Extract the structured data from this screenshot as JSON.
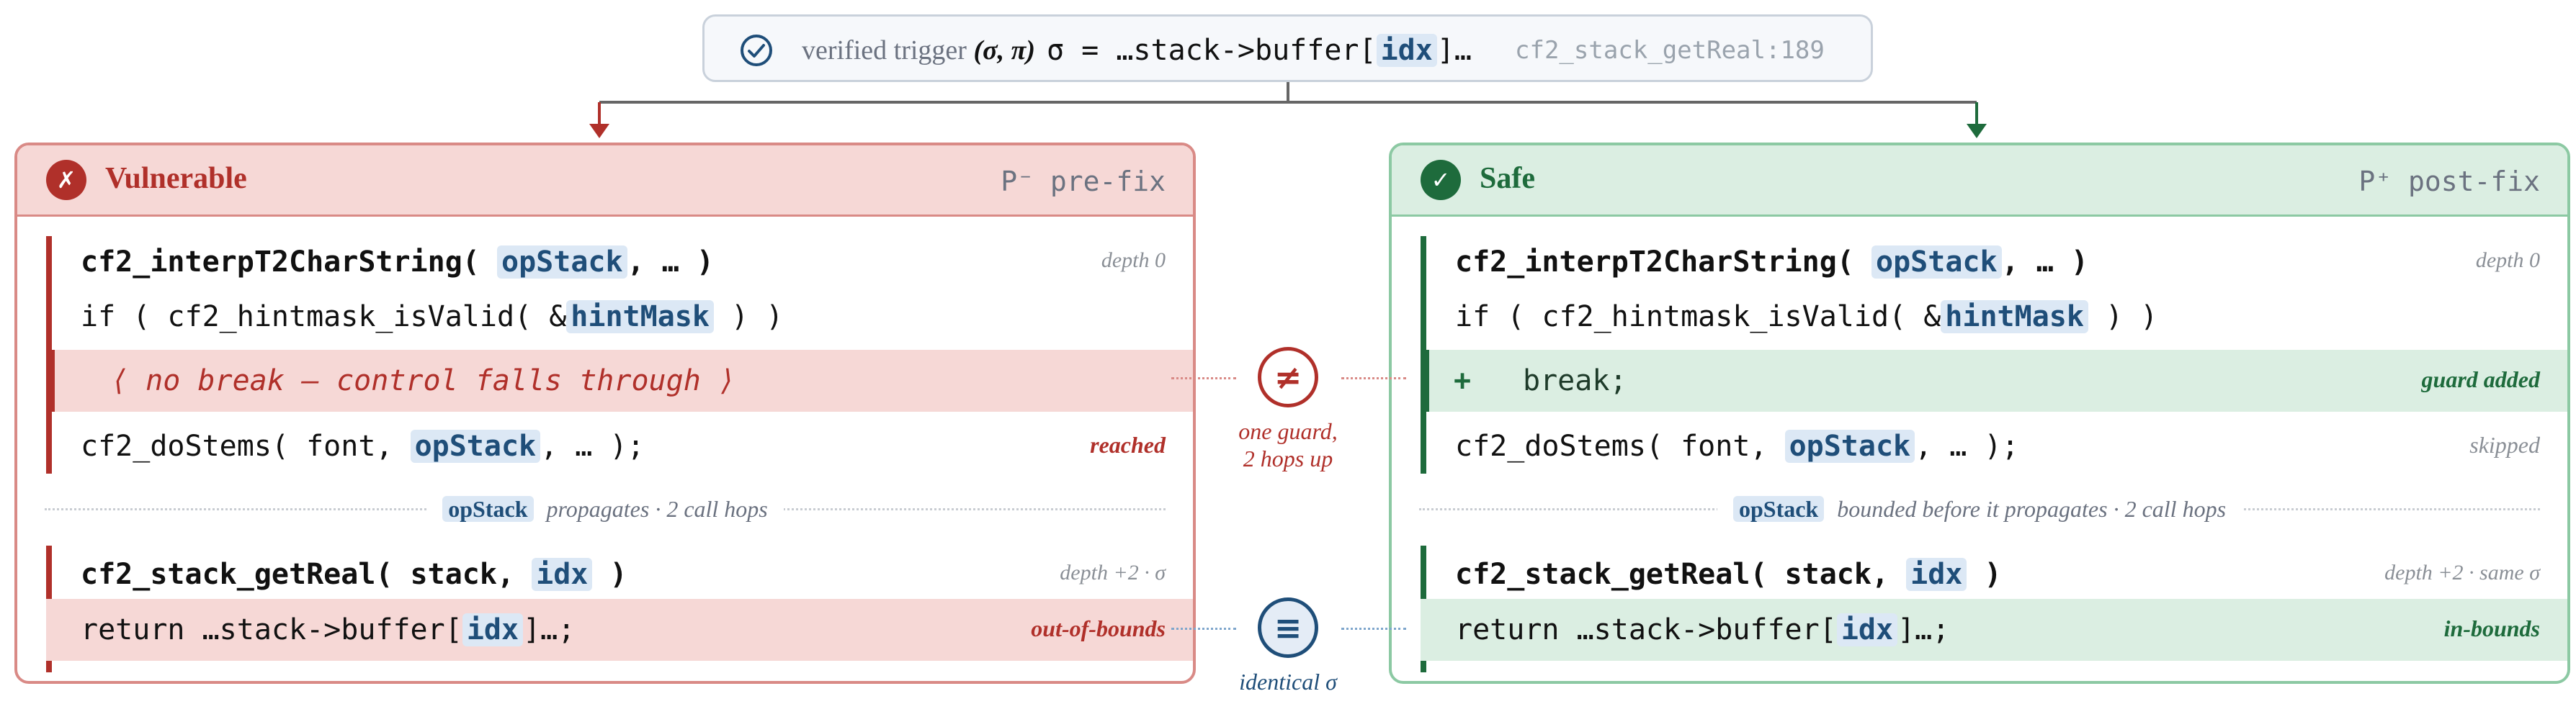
{
  "trigger": {
    "label": "verified trigger",
    "pair": "(σ, π)",
    "expr_prefix": "σ = …stack->buffer[",
    "expr_token": "idx",
    "expr_suffix": "]…",
    "location": "cf2_stack_getReal:189"
  },
  "vulnerable": {
    "badge": "✗",
    "title": "Vulnerable",
    "subtitle": "P⁻ pre-fix",
    "fn_name": "cf2_interpT2CharString(",
    "fn_token": "opStack",
    "fn_rest": ", … )",
    "fn_note": "depth 0",
    "if_prefix": "if ( cf2_hintmask_isValid( &",
    "if_token": "hintMask",
    "if_suffix": " ) )",
    "missing_line": "⟨ no break — control falls through ⟩",
    "stems_prefix": "cf2_doStems( font, ",
    "stems_token": "opStack",
    "stems_suffix": ", … );",
    "stems_note": "reached",
    "sep_token": "opStack",
    "sep_text": "propagates · 2 call hops",
    "getreal_prefix": "cf2_stack_getReal( stack, ",
    "getreal_token": "idx",
    "getreal_suffix": " )",
    "getreal_note": "depth +2 · σ",
    "return_prefix": "return …stack->buffer[",
    "return_token": "idx",
    "return_suffix": "]…;",
    "return_note": "out-of-bounds"
  },
  "safe": {
    "badge": "✓",
    "title": "Safe",
    "subtitle": "P⁺ post-fix",
    "fn_name": "cf2_interpT2CharString(",
    "fn_token": "opStack",
    "fn_rest": ", … )",
    "fn_note": "depth 0",
    "if_prefix": "if ( cf2_hintmask_isValid( &",
    "if_token": "hintMask",
    "if_suffix": " ) )",
    "added_plus": "+",
    "added_line": "break;",
    "added_note": "guard added",
    "stems_prefix": "cf2_doStems( font, ",
    "stems_token": "opStack",
    "stems_suffix": ", … );",
    "stems_note": "skipped",
    "sep_token": "opStack",
    "sep_text": "bounded before it propagates · 2 call hops",
    "getreal_prefix": "cf2_stack_getReal( stack, ",
    "getreal_token": "idx",
    "getreal_suffix": " )",
    "getreal_note": "depth +2 · same σ",
    "return_prefix": "return …stack->buffer[",
    "return_token": "idx",
    "return_suffix": "]…;",
    "return_note": "in-bounds"
  },
  "middle": {
    "neq_symbol": "≠",
    "neq_label_1": "one guard,",
    "neq_label_2": "2 hops up",
    "eq_symbol": "≡",
    "eq_label": "identical σ"
  },
  "colors": {
    "red": "#b0302a",
    "green": "#1e6b3c",
    "blue": "#1f4e79",
    "red_band": "#f6d8d6",
    "green_band": "#dbeee2"
  }
}
